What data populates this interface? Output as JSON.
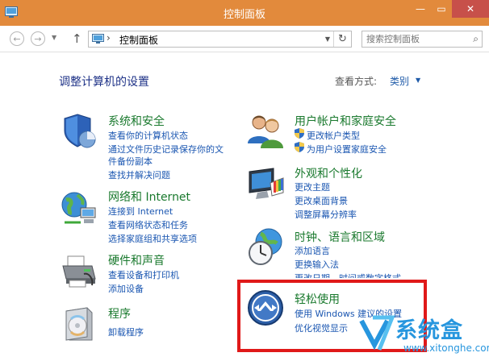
{
  "window": {
    "title": "控制面板",
    "minimize_icon": "minimize-icon",
    "maximize_icon": "maximize-icon",
    "close_icon": "close-icon"
  },
  "navbar": {
    "back_icon": "back-arrow-icon",
    "forward_icon": "forward-arrow-icon",
    "recent_icon": "chevron-down-icon",
    "up_icon": "up-arrow-icon",
    "address_separator": "›",
    "address_path": "控制面板",
    "refresh_icon": "refresh-icon",
    "search_placeholder": "搜索控制面板",
    "search_icon": "search-icon"
  },
  "main": {
    "heading": "调整计算机的设置",
    "view_by_label": "查看方式:",
    "view_by_value": "类别"
  },
  "categories": [
    {
      "title": "系统和安全",
      "icon": "shield-icon",
      "links": [
        "查看你的计算机状态",
        "通过文件历史记录保存你的文",
        "件备份副本",
        "查找并解决问题"
      ]
    },
    {
      "title": "网络和 Internet",
      "icon": "network-globe-icon",
      "links": [
        "连接到 Internet",
        "查看网络状态和任务",
        "选择家庭组和共享选项"
      ]
    },
    {
      "title": "硬件和声音",
      "icon": "printer-icon",
      "links": [
        "查看设备和打印机",
        "添加设备"
      ]
    },
    {
      "title": "程序",
      "icon": "programs-disc-icon",
      "links": [
        "卸载程序"
      ]
    },
    {
      "title": "用户帐户和家庭安全",
      "icon": "users-icon",
      "links": [
        "更改帐户类型",
        "为用户设置家庭安全"
      ]
    },
    {
      "title": "外观和个性化",
      "icon": "monitor-palette-icon",
      "links": [
        "更改主题",
        "更改桌面背景",
        "调整屏幕分辨率"
      ]
    },
    {
      "title": "时钟、语言和区域",
      "icon": "clock-globe-icon",
      "links": [
        "添加语言",
        "更换输入法",
        "更改日期、时间或数字格式"
      ]
    },
    {
      "title": "轻松使用",
      "icon": "ease-of-access-icon",
      "links": [
        "使用 Windows 建议的设置",
        "优化视觉显示"
      ]
    }
  ],
  "watermark": {
    "text": "系统盒",
    "url": "www.xitonghe.com",
    "logo_icon": "xitonghe-logo-icon"
  },
  "colors": {
    "titlebar": "#e28a3c",
    "category_title": "#19792d",
    "link": "#1a56b1",
    "heading": "#1e3287",
    "highlight_box": "#e01919"
  }
}
